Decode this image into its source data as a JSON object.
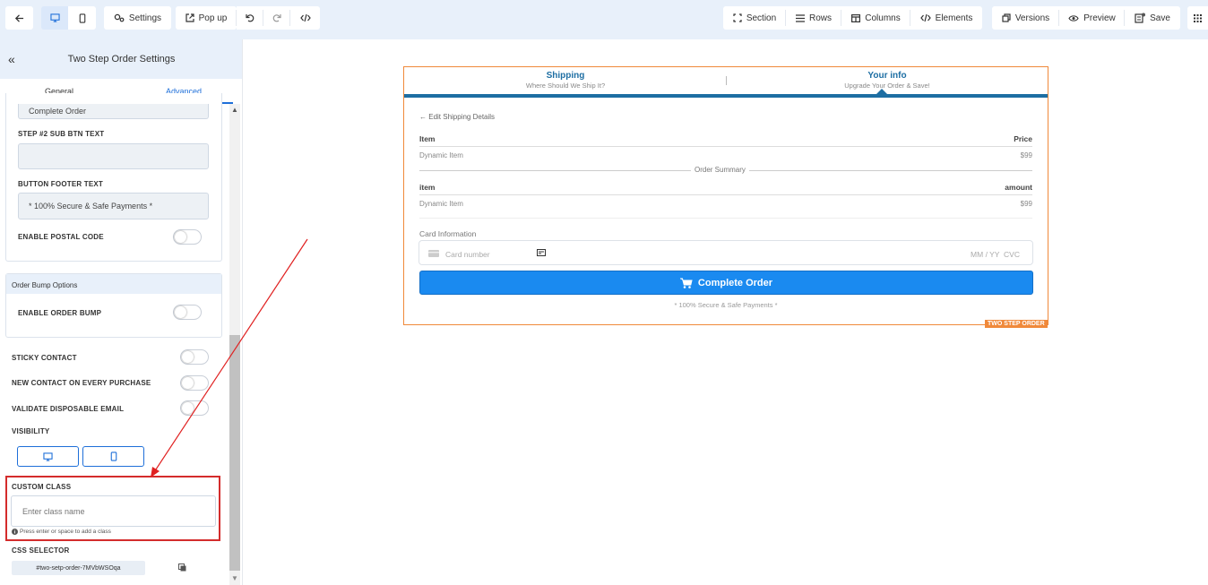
{
  "toolbar": {
    "settings_label": "Settings",
    "popup_label": "Pop up",
    "section_label": "Section",
    "rows_label": "Rows",
    "columns_label": "Columns",
    "elements_label": "Elements",
    "versions_label": "Versions",
    "preview_label": "Preview",
    "save_label": "Save",
    "accent": "#1e6fd9"
  },
  "sidebar": {
    "title": "Two Step Order Settings",
    "tabs": [
      "General",
      "Advanced"
    ],
    "active_tab": "Advanced",
    "complete_order_value": "Complete Order",
    "step2_sub_label": "STEP #2 SUB BTN TEXT",
    "step2_sub_value": "",
    "footer_text_label": "BUTTON FOOTER TEXT",
    "footer_text_value": "* 100% Secure & Safe Payments *",
    "postal_label": "ENABLE POSTAL CODE",
    "bump_section_title": "Order Bump Options",
    "bump_label": "ENABLE ORDER BUMP",
    "sticky_label": "STICKY CONTACT",
    "new_contact_label": "NEW CONTACT ON EVERY PURCHASE",
    "disposable_label": "VALIDATE DISPOSABLE EMAIL",
    "visibility_label": "VISIBILITY",
    "custom_class_label": "CUSTOM CLASS",
    "custom_class_placeholder": "Enter class name",
    "custom_class_hint": "Press enter or space to add a class",
    "css_selector_label": "CSS SELECTOR",
    "css_selector_value": "#two-setp-order-7MVbWSOqa"
  },
  "form": {
    "step1_title": "Shipping",
    "step1_sub": "Where Should We Ship It?",
    "step2_title": "Your info",
    "step2_sub": "Upgrade Your Order & Save!",
    "edit_link": "Edit Shipping Details",
    "table1_headers": [
      "Item",
      "Price"
    ],
    "table1_rows": [
      [
        "Dynamic Item",
        "$99"
      ]
    ],
    "summary_label": "Order Summary",
    "table2_headers": [
      "item",
      "amount"
    ],
    "table2_rows": [
      [
        "Dynamic Item",
        "$99"
      ]
    ],
    "card_info_label": "Card Information",
    "card_number_placeholder": "Card number",
    "card_date_cvc": "MM / YY  CVC",
    "submit_label": "Complete Order",
    "footer_text": "* 100% Secure & Safe Payments *",
    "badge": "TWO STEP ORDER",
    "button_color": "#1a8af0",
    "border_color": "#f0893a",
    "step_bar_color": "#1d6ea3"
  }
}
